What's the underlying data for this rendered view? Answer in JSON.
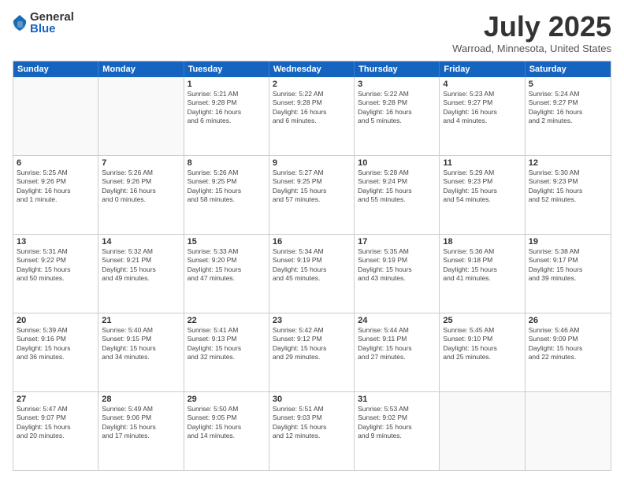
{
  "logo": {
    "general": "General",
    "blue": "Blue"
  },
  "header": {
    "month": "July 2025",
    "location": "Warroad, Minnesota, United States"
  },
  "weekdays": [
    "Sunday",
    "Monday",
    "Tuesday",
    "Wednesday",
    "Thursday",
    "Friday",
    "Saturday"
  ],
  "rows": [
    [
      {
        "day": "",
        "lines": []
      },
      {
        "day": "",
        "lines": []
      },
      {
        "day": "1",
        "lines": [
          "Sunrise: 5:21 AM",
          "Sunset: 9:28 PM",
          "Daylight: 16 hours",
          "and 6 minutes."
        ]
      },
      {
        "day": "2",
        "lines": [
          "Sunrise: 5:22 AM",
          "Sunset: 9:28 PM",
          "Daylight: 16 hours",
          "and 6 minutes."
        ]
      },
      {
        "day": "3",
        "lines": [
          "Sunrise: 5:22 AM",
          "Sunset: 9:28 PM",
          "Daylight: 16 hours",
          "and 5 minutes."
        ]
      },
      {
        "day": "4",
        "lines": [
          "Sunrise: 5:23 AM",
          "Sunset: 9:27 PM",
          "Daylight: 16 hours",
          "and 4 minutes."
        ]
      },
      {
        "day": "5",
        "lines": [
          "Sunrise: 5:24 AM",
          "Sunset: 9:27 PM",
          "Daylight: 16 hours",
          "and 2 minutes."
        ]
      }
    ],
    [
      {
        "day": "6",
        "lines": [
          "Sunrise: 5:25 AM",
          "Sunset: 9:26 PM",
          "Daylight: 16 hours",
          "and 1 minute."
        ]
      },
      {
        "day": "7",
        "lines": [
          "Sunrise: 5:26 AM",
          "Sunset: 9:26 PM",
          "Daylight: 16 hours",
          "and 0 minutes."
        ]
      },
      {
        "day": "8",
        "lines": [
          "Sunrise: 5:26 AM",
          "Sunset: 9:25 PM",
          "Daylight: 15 hours",
          "and 58 minutes."
        ]
      },
      {
        "day": "9",
        "lines": [
          "Sunrise: 5:27 AM",
          "Sunset: 9:25 PM",
          "Daylight: 15 hours",
          "and 57 minutes."
        ]
      },
      {
        "day": "10",
        "lines": [
          "Sunrise: 5:28 AM",
          "Sunset: 9:24 PM",
          "Daylight: 15 hours",
          "and 55 minutes."
        ]
      },
      {
        "day": "11",
        "lines": [
          "Sunrise: 5:29 AM",
          "Sunset: 9:23 PM",
          "Daylight: 15 hours",
          "and 54 minutes."
        ]
      },
      {
        "day": "12",
        "lines": [
          "Sunrise: 5:30 AM",
          "Sunset: 9:23 PM",
          "Daylight: 15 hours",
          "and 52 minutes."
        ]
      }
    ],
    [
      {
        "day": "13",
        "lines": [
          "Sunrise: 5:31 AM",
          "Sunset: 9:22 PM",
          "Daylight: 15 hours",
          "and 50 minutes."
        ]
      },
      {
        "day": "14",
        "lines": [
          "Sunrise: 5:32 AM",
          "Sunset: 9:21 PM",
          "Daylight: 15 hours",
          "and 49 minutes."
        ]
      },
      {
        "day": "15",
        "lines": [
          "Sunrise: 5:33 AM",
          "Sunset: 9:20 PM",
          "Daylight: 15 hours",
          "and 47 minutes."
        ]
      },
      {
        "day": "16",
        "lines": [
          "Sunrise: 5:34 AM",
          "Sunset: 9:19 PM",
          "Daylight: 15 hours",
          "and 45 minutes."
        ]
      },
      {
        "day": "17",
        "lines": [
          "Sunrise: 5:35 AM",
          "Sunset: 9:19 PM",
          "Daylight: 15 hours",
          "and 43 minutes."
        ]
      },
      {
        "day": "18",
        "lines": [
          "Sunrise: 5:36 AM",
          "Sunset: 9:18 PM",
          "Daylight: 15 hours",
          "and 41 minutes."
        ]
      },
      {
        "day": "19",
        "lines": [
          "Sunrise: 5:38 AM",
          "Sunset: 9:17 PM",
          "Daylight: 15 hours",
          "and 39 minutes."
        ]
      }
    ],
    [
      {
        "day": "20",
        "lines": [
          "Sunrise: 5:39 AM",
          "Sunset: 9:16 PM",
          "Daylight: 15 hours",
          "and 36 minutes."
        ]
      },
      {
        "day": "21",
        "lines": [
          "Sunrise: 5:40 AM",
          "Sunset: 9:15 PM",
          "Daylight: 15 hours",
          "and 34 minutes."
        ]
      },
      {
        "day": "22",
        "lines": [
          "Sunrise: 5:41 AM",
          "Sunset: 9:13 PM",
          "Daylight: 15 hours",
          "and 32 minutes."
        ]
      },
      {
        "day": "23",
        "lines": [
          "Sunrise: 5:42 AM",
          "Sunset: 9:12 PM",
          "Daylight: 15 hours",
          "and 29 minutes."
        ]
      },
      {
        "day": "24",
        "lines": [
          "Sunrise: 5:44 AM",
          "Sunset: 9:11 PM",
          "Daylight: 15 hours",
          "and 27 minutes."
        ]
      },
      {
        "day": "25",
        "lines": [
          "Sunrise: 5:45 AM",
          "Sunset: 9:10 PM",
          "Daylight: 15 hours",
          "and 25 minutes."
        ]
      },
      {
        "day": "26",
        "lines": [
          "Sunrise: 5:46 AM",
          "Sunset: 9:09 PM",
          "Daylight: 15 hours",
          "and 22 minutes."
        ]
      }
    ],
    [
      {
        "day": "27",
        "lines": [
          "Sunrise: 5:47 AM",
          "Sunset: 9:07 PM",
          "Daylight: 15 hours",
          "and 20 minutes."
        ]
      },
      {
        "day": "28",
        "lines": [
          "Sunrise: 5:49 AM",
          "Sunset: 9:06 PM",
          "Daylight: 15 hours",
          "and 17 minutes."
        ]
      },
      {
        "day": "29",
        "lines": [
          "Sunrise: 5:50 AM",
          "Sunset: 9:05 PM",
          "Daylight: 15 hours",
          "and 14 minutes."
        ]
      },
      {
        "day": "30",
        "lines": [
          "Sunrise: 5:51 AM",
          "Sunset: 9:03 PM",
          "Daylight: 15 hours",
          "and 12 minutes."
        ]
      },
      {
        "day": "31",
        "lines": [
          "Sunrise: 5:53 AM",
          "Sunset: 9:02 PM",
          "Daylight: 15 hours",
          "and 9 minutes."
        ]
      },
      {
        "day": "",
        "lines": []
      },
      {
        "day": "",
        "lines": []
      }
    ]
  ]
}
